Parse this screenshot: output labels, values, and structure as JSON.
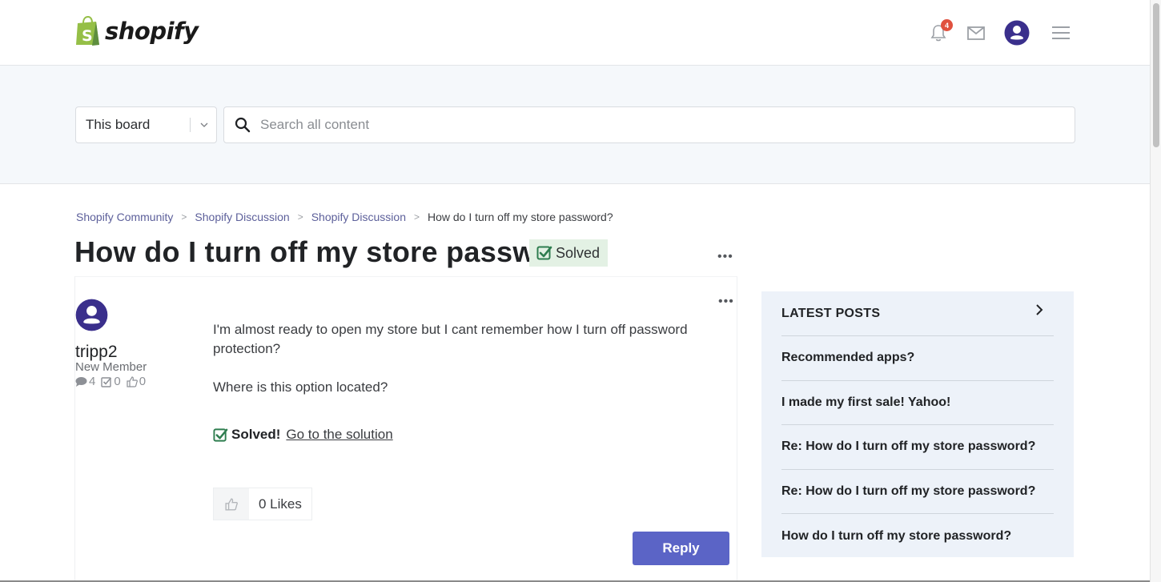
{
  "header": {
    "brand": "shopify",
    "notifications_count": "4",
    "icons": {
      "notifications": "bell-icon",
      "messages": "envelope-icon",
      "profile": "user-avatar-icon",
      "menu": "hamburger-menu-icon"
    }
  },
  "search": {
    "scope_selected": "This board",
    "placeholder": "Search all content",
    "value": ""
  },
  "breadcrumb": [
    "Shopify Community",
    "Shopify Discussion",
    "Shopify Discussion",
    "How do I turn off my store password?"
  ],
  "topic": {
    "title": "How do I turn off my store password?",
    "status_label": "Solved",
    "more_label": "•••"
  },
  "post": {
    "author": {
      "name": "tripp2",
      "rank": "New Member",
      "stats": {
        "messages": "4",
        "solutions": "0",
        "kudos": "0"
      }
    },
    "body": [
      "I'm almost ready to open my store but I cant remember how I turn off password protection?",
      "Where is this option located?"
    ],
    "solved_label": "Solved!",
    "solution_link": "Go to the solution",
    "likes_label": "0 Likes",
    "reply_label": "Reply",
    "more_label": "•••"
  },
  "sidebar": {
    "latest_title": "LATEST POSTS",
    "latest_posts": [
      "Recommended apps?",
      "I made my first sale! Yahoo!",
      "Re: How do I turn off my store password?",
      "Re: How do I turn off my store password?",
      "How do I turn off my store password?"
    ]
  },
  "colors": {
    "brand_green": "#95bf47",
    "accent_purple": "#5b64c6",
    "avatar_navy": "#3a2f8c",
    "solved_green": "#2e8b57",
    "badge_red": "#e0513e"
  }
}
